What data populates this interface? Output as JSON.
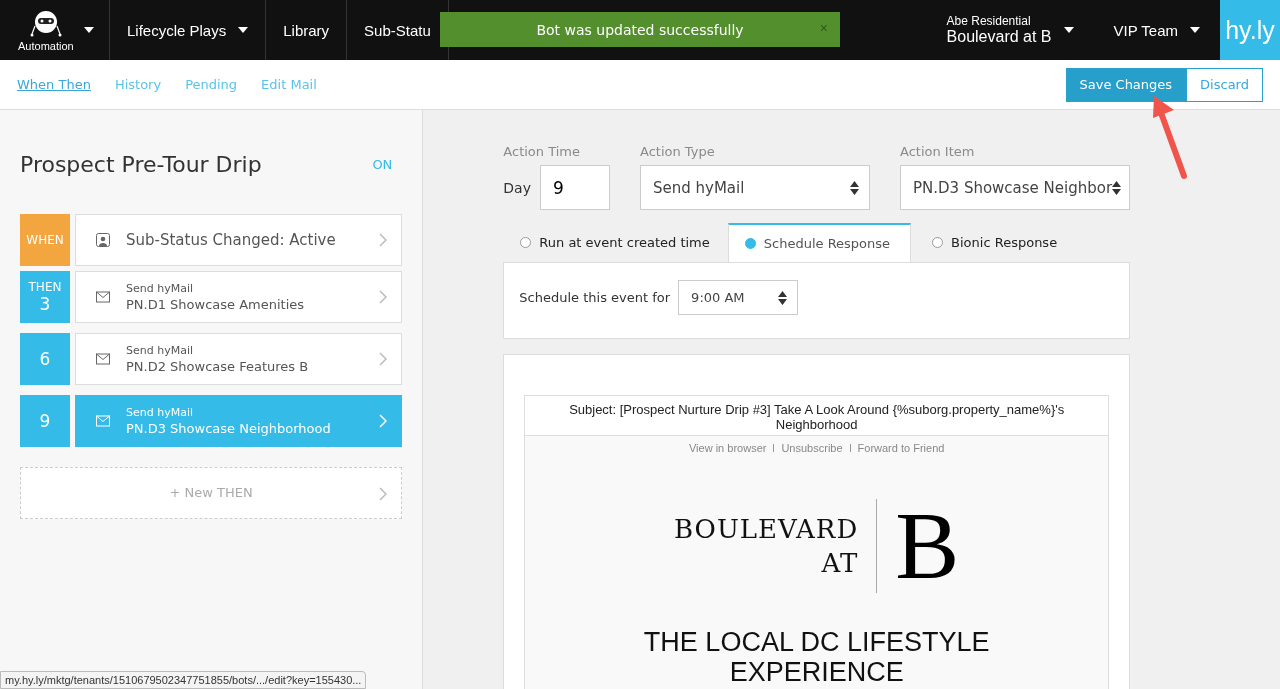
{
  "topbar": {
    "app_menu": {
      "label": "Automation"
    },
    "nav": [
      {
        "label": "Lifecycle Plays",
        "dropdown": true
      },
      {
        "label": "Library",
        "dropdown": false
      },
      {
        "label": "Sub-Statu",
        "dropdown": false
      }
    ],
    "account": {
      "company": "Abe Residential",
      "property": "Boulevard at B"
    },
    "team": {
      "label": "VIP Team"
    },
    "logo": "hy.ly"
  },
  "toast": {
    "message": "Bot was updated successfully",
    "close": "×"
  },
  "subnav": {
    "tabs": [
      {
        "label": "When Then",
        "selected": true
      },
      {
        "label": "History",
        "selected": false
      },
      {
        "label": "Pending",
        "selected": false
      },
      {
        "label": "Edit Mail",
        "selected": false
      }
    ],
    "buttons": [
      {
        "label": "Save Changes",
        "kind": "primary"
      },
      {
        "label": "Discard",
        "kind": "secondary"
      }
    ]
  },
  "bot": {
    "title": "Prospect Pre-Tour Drip",
    "status": "ON",
    "steps": [
      {
        "kind": "when",
        "badge": "WHEN",
        "name": "Sub-Status Changed: Active",
        "selected": false
      },
      {
        "kind": "then",
        "badge": "THEN",
        "day": "3",
        "action": "Send hyMail",
        "name": "PN.D1 Showcase Amenities",
        "selected": false
      },
      {
        "kind": "then",
        "day": "6",
        "action": "Send hyMail",
        "name": "PN.D2 Showcase Features B",
        "selected": false
      },
      {
        "kind": "then",
        "day": "9",
        "action": "Send hyMail",
        "name": "PN.D3 Showcase Neighborhood",
        "selected": true
      }
    ],
    "new_step": "+ New THEN"
  },
  "editor": {
    "action_time": {
      "label": "Action Time",
      "prefix": "Day",
      "value": "9"
    },
    "action_type": {
      "label": "Action Type",
      "value": "Send hyMail"
    },
    "action_item": {
      "label": "Action Item",
      "value": "PN.D3 Showcase Neighbor"
    },
    "timing": [
      {
        "label": "Run at event created time",
        "selected": false
      },
      {
        "label": "Schedule Response",
        "selected": true
      },
      {
        "label": "Bionic Response",
        "selected": false
      }
    ],
    "schedule": {
      "label": "Schedule this event for",
      "value": "9:00 AM"
    },
    "preview": {
      "subject": "Subject: [Prospect Nurture Drip #3] Take A Look Around {%suborg.property_name%}'s Neighborhood",
      "links": [
        "View in browser",
        "Unsubscribe",
        "Forward to Friend"
      ],
      "logo_words": [
        "BOULEVARD",
        "AT"
      ],
      "logo_letter": "B",
      "headline": "THE LOCAL DC LIFESTYLE EXPERIENCE"
    }
  },
  "status_url": "my.hy.ly/mktg/tenants/1510679502347751855/bots/.../edit?key=155430..."
}
